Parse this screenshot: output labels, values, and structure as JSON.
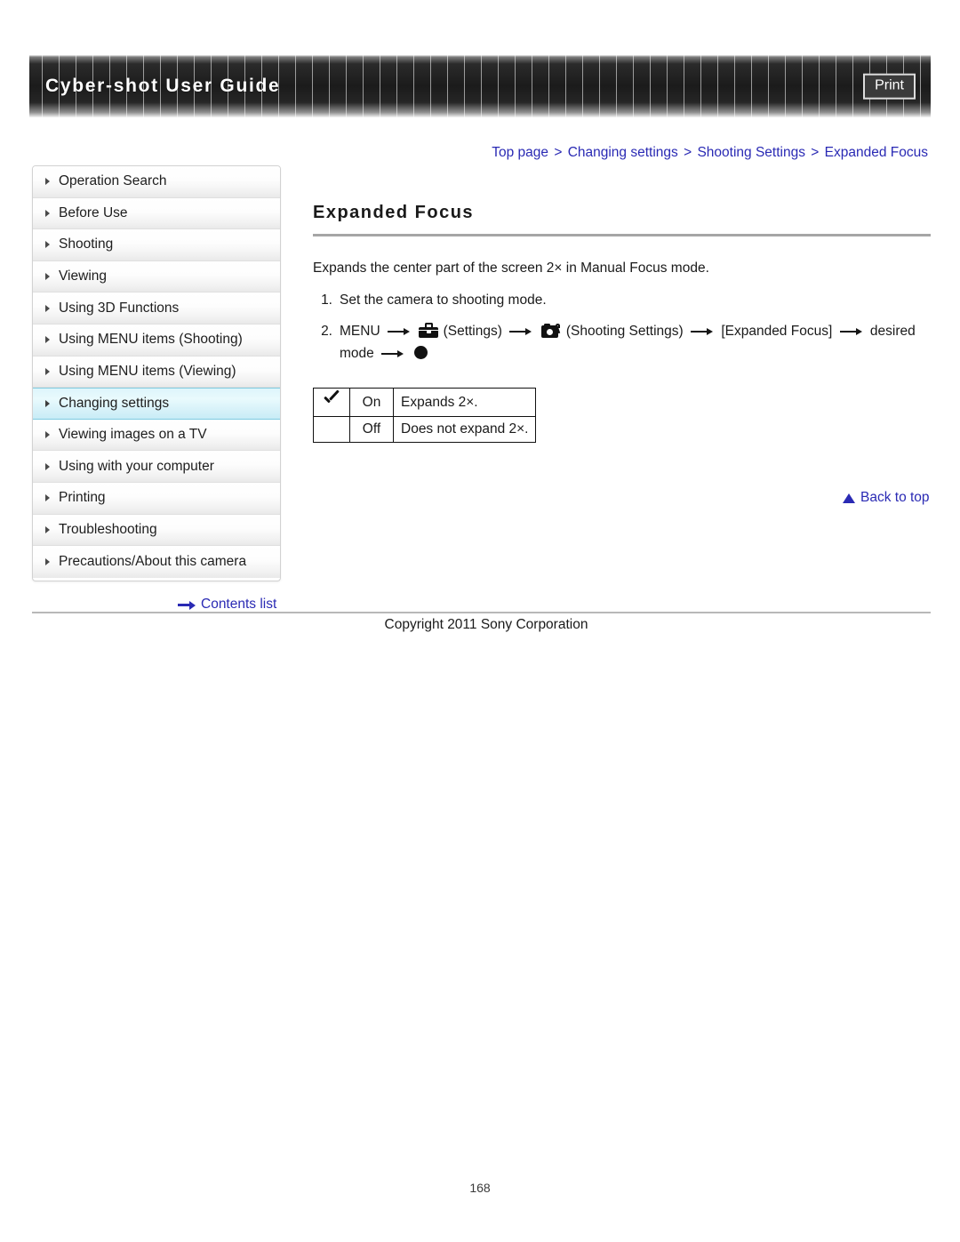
{
  "header": {
    "title": "Cyber-shot User Guide",
    "print_label": "Print"
  },
  "breadcrumb": {
    "items": [
      "Top page",
      "Changing settings",
      "Shooting Settings",
      "Expanded Focus"
    ],
    "separator": ">"
  },
  "sidebar": {
    "items": [
      {
        "label": "Operation Search",
        "active": false
      },
      {
        "label": "Before Use",
        "active": false
      },
      {
        "label": "Shooting",
        "active": false
      },
      {
        "label": "Viewing",
        "active": false
      },
      {
        "label": "Using 3D Functions",
        "active": false
      },
      {
        "label": "Using MENU items (Shooting)",
        "active": false
      },
      {
        "label": "Using MENU items (Viewing)",
        "active": false
      },
      {
        "label": "Changing settings",
        "active": true
      },
      {
        "label": "Viewing images on a TV",
        "active": false
      },
      {
        "label": "Using with your computer",
        "active": false
      },
      {
        "label": "Printing",
        "active": false
      },
      {
        "label": "Troubleshooting",
        "active": false
      },
      {
        "label": "Precautions/About this camera",
        "active": false
      }
    ],
    "contents_list_label": "Contents list"
  },
  "main": {
    "title": "Expanded Focus",
    "lead": "Expands the center part of the screen 2× in Manual Focus mode.",
    "steps": [
      {
        "number": "1.",
        "text": "Set the camera to shooting mode."
      },
      {
        "number": "2.",
        "menu_label": "MENU",
        "settings_label": "(Settings)",
        "shooting_settings_label": "(Shooting Settings)",
        "item_label": "[Expanded Focus]",
        "desired_label": "desired",
        "mode_label": "mode"
      }
    ],
    "options_table": {
      "rows": [
        {
          "checked": true,
          "name": "On",
          "description": "Expands 2×."
        },
        {
          "checked": false,
          "name": "Off",
          "description": "Does not expand 2×."
        }
      ]
    },
    "back_to_top_label": "Back to top"
  },
  "footer": {
    "copyright": "Copyright 2011 Sony Corporation",
    "page_number": "168"
  },
  "colors": {
    "link": "#2a2ab4",
    "rule": "#a6a6a6",
    "active_nav_border": "#7fcbe0"
  }
}
